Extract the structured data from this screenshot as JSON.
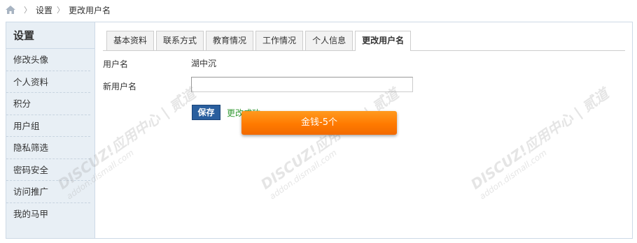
{
  "breadcrumb": {
    "items": [
      "设置",
      "更改用户名"
    ]
  },
  "sidebar": {
    "title": "设置",
    "items": [
      {
        "label": "修改头像"
      },
      {
        "label": "个人资料"
      },
      {
        "label": "积分"
      },
      {
        "label": "用户组"
      },
      {
        "label": "隐私筛选"
      },
      {
        "label": "密码安全"
      },
      {
        "label": "访问推广"
      },
      {
        "label": "我的马甲"
      }
    ]
  },
  "tabs": [
    {
      "label": "基本资料"
    },
    {
      "label": "联系方式"
    },
    {
      "label": "教育情况"
    },
    {
      "label": "工作情况"
    },
    {
      "label": "个人信息"
    },
    {
      "label": "更改用户名",
      "active": true
    }
  ],
  "form": {
    "username_label": "用户名",
    "username_value": "湖中沉",
    "new_username_label": "新用户名",
    "new_username_value": "",
    "save_label": "保存",
    "success_text": "更改成功"
  },
  "toast": {
    "text": "金钱-5个"
  },
  "watermark": {
    "text": "DISCUZ!应用中心 | 贰道",
    "sub": "addon.dismall.com"
  },
  "colors": {
    "sidebar_bg": "#e8eff5",
    "save_button": "#2a5f9e",
    "success_text": "#339933",
    "toast": "#ff7a00"
  }
}
